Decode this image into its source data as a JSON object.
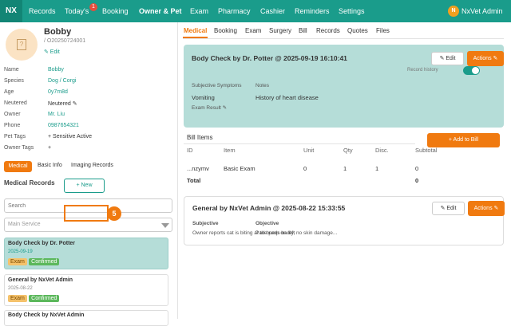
{
  "nav": {
    "logo": "NX",
    "items": [
      "Records",
      "Today's",
      "Booking",
      "Owner & Pet",
      "Exam",
      "Pharmacy",
      "Cashier",
      "Reminders",
      "Settings"
    ],
    "today_badge": "1",
    "user_initial": "N",
    "user_name": "NxVet Admin"
  },
  "pet": {
    "name": "Bobby",
    "id": "/ O20250724001",
    "edit": "✎ Edit",
    "avatar_icon": "?",
    "fields": [
      {
        "label": "Name",
        "value": "Bobby"
      },
      {
        "label": "Species",
        "value": "Dog / Corgi"
      },
      {
        "label": "Age",
        "value": "0y7m8d"
      },
      {
        "label": "Neutered",
        "value": "Neutered ✎"
      },
      {
        "label": "Owner",
        "value": "Mr. Liu"
      },
      {
        "label": "Phone",
        "value": "0987654321"
      },
      {
        "label": "Pet Tags",
        "value": "+ Sensitive Active"
      },
      {
        "label": "Owner Tags",
        "value": "+"
      }
    ]
  },
  "left_tabs": [
    "Medical",
    "Basic Info",
    "Imaging Records"
  ],
  "medical_records": {
    "title": "Medical Records",
    "new_button": "+ New",
    "search_placeholder": "Search",
    "service_placeholder": "Main Service",
    "marker": "5",
    "records": [
      {
        "title": "Body Check by Dr. Potter",
        "date": "2025-09-19",
        "tags": [
          "Exam",
          "Confirmed"
        ]
      },
      {
        "title": "General by NxVet Admin",
        "date": "2025-08-22",
        "tags": [
          "Exam",
          "Confirmed"
        ]
      },
      {
        "title": "Body Check by NxVet Admin",
        "date": "",
        "tags": []
      }
    ]
  },
  "right_tabs": [
    "Medical",
    "Booking",
    "Exam",
    "Surgery",
    "Bill",
    "Records",
    "Quotes",
    "Files"
  ],
  "record1": {
    "title": "Body Check by Dr. Potter @ 2025-09-19 16:10:41",
    "edit": "✎ Edit",
    "actions": "Actions ✎",
    "record_history": "Record history",
    "subjective_label": "Subjective Symptoms",
    "subjective_value": "Vomiting",
    "notes_label": "Notes",
    "notes_value": "History of heart disease",
    "exam_result": "Exam Result ✎"
  },
  "bill": {
    "title": "Bill Items",
    "add_button": "+ Add to Bill",
    "headers": [
      "ID",
      "Item",
      "Unit",
      "Qty",
      "Disc.",
      "Subtotal"
    ],
    "row": [
      "...nzymv",
      "Basic Exam",
      "0",
      "1",
      "1",
      "0"
    ],
    "total_label": "Total",
    "total_value": "0"
  },
  "record2": {
    "title": "General by NxVet Admin @ 2025-08-22 15:33:55",
    "edit": "✎ Edit",
    "actions": "Actions ✎",
    "subjective_label": "Subjective",
    "subjective_value": "Owner reports cat is biting at the pads badly, no skin damage...",
    "objective_label": "Objective",
    "objective_value": "Pad bump on left"
  }
}
